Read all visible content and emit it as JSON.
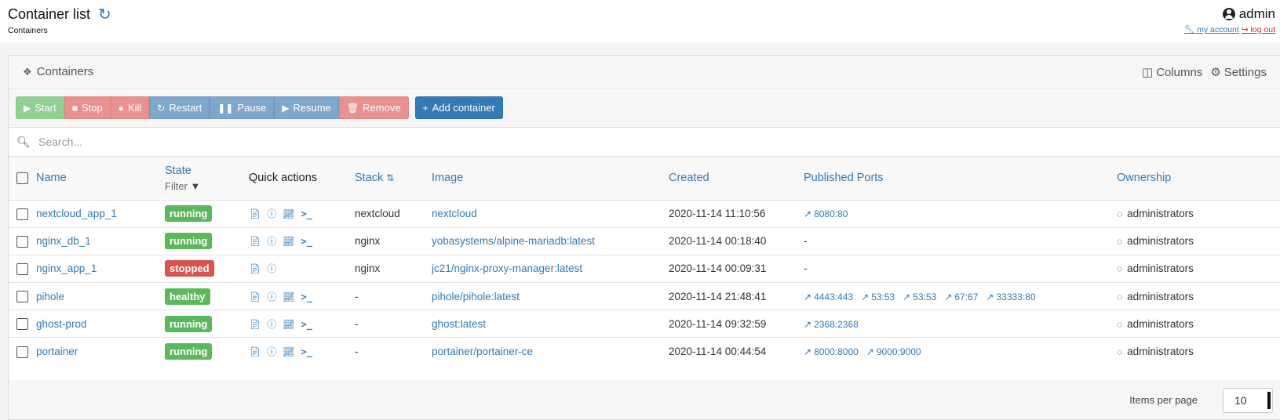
{
  "header": {
    "title": "Container list",
    "breadcrumb": "Containers",
    "username": "admin",
    "my_account": "my account",
    "log_out": "log out"
  },
  "widget": {
    "title": "Containers",
    "columns_label": "Columns",
    "settings_label": "Settings"
  },
  "actions": {
    "start": "Start",
    "stop": "Stop",
    "kill": "Kill",
    "restart": "Restart",
    "pause": "Pause",
    "resume": "Resume",
    "remove": "Remove",
    "add": "Add container"
  },
  "search": {
    "placeholder": "Search..."
  },
  "table": {
    "columns": {
      "name": "Name",
      "state": "State",
      "state_filter": "Filter",
      "quick_actions": "Quick actions",
      "stack": "Stack",
      "image": "Image",
      "created": "Created",
      "ports": "Published Ports",
      "ownership": "Ownership"
    },
    "rows": [
      {
        "name": "nextcloud_app_1",
        "state": "running",
        "state_color": "#5cb85c",
        "quick": [
          "logs",
          "inspect",
          "stats",
          "console"
        ],
        "stack": "nextcloud",
        "image": "nextcloud",
        "created": "2020-11-14 11:10:56",
        "ports": [
          "8080:80"
        ],
        "ownership": "administrators"
      },
      {
        "name": "nginx_db_1",
        "state": "running",
        "state_color": "#5cb85c",
        "quick": [
          "logs",
          "inspect",
          "stats",
          "console"
        ],
        "stack": "nginx",
        "image": "yobasystems/alpine-mariadb:latest",
        "created": "2020-11-14 00:18:40",
        "ports_text": "-",
        "ownership": "administrators"
      },
      {
        "name": "nginx_app_1",
        "state": "stopped",
        "state_color": "#d9534f",
        "quick": [
          "logs",
          "inspect"
        ],
        "stack": "nginx",
        "image": "jc21/nginx-proxy-manager:latest",
        "created": "2020-11-14 00:09:31",
        "ports_text": "-",
        "ownership": "administrators"
      },
      {
        "name": "pihole",
        "state": "healthy",
        "state_color": "#5cb85c",
        "quick": [
          "logs",
          "inspect",
          "stats",
          "console"
        ],
        "stack": "-",
        "image": "pihole/pihole:latest",
        "created": "2020-11-14 21:48:41",
        "ports": [
          "4443:443",
          "53:53",
          "53:53",
          "67:67",
          "33333:80"
        ],
        "ownership": "administrators"
      },
      {
        "name": "ghost-prod",
        "state": "running",
        "state_color": "#5cb85c",
        "quick": [
          "logs",
          "inspect",
          "stats",
          "console"
        ],
        "stack": "-",
        "image": "ghost:latest",
        "created": "2020-11-14 09:32:59",
        "ports": [
          "2368:2368"
        ],
        "ownership": "administrators"
      },
      {
        "name": "portainer",
        "state": "running",
        "state_color": "#5cb85c",
        "quick": [
          "logs",
          "inspect",
          "stats",
          "console"
        ],
        "stack": "-",
        "image": "portainer/portainer-ce",
        "created": "2020-11-14 00:44:54",
        "ports": [
          "8000:8000",
          "9000:9000"
        ],
        "ownership": "administrators"
      }
    ]
  },
  "footer": {
    "items_per_page_label": "Items per page",
    "items_per_page_value": "10"
  },
  "icons": {
    "refresh": "refresh-icon",
    "user": "user-circle-icon",
    "containers": "cubes-icon",
    "columns": "columns-icon",
    "settings": "gear-icon",
    "search": "search-icon",
    "filter": "filter-icon",
    "sort": "sort-icon",
    "external": "external-link-icon",
    "ownership": "eye-slash-icon"
  }
}
